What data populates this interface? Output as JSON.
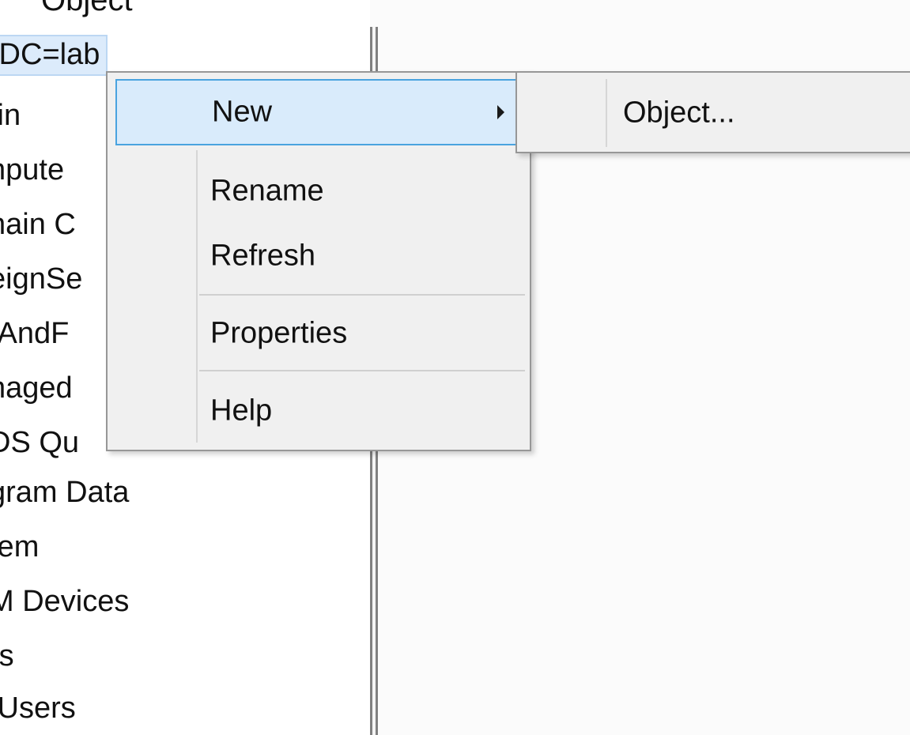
{
  "tree": {
    "column_header": "Object",
    "items": [
      {
        "label": ",DC=lab",
        "selected": true
      },
      {
        "label": "tin",
        "selected": false
      },
      {
        "label": "npute",
        "selected": false
      },
      {
        "label": "nain C",
        "selected": false
      },
      {
        "label": "eignSe",
        "selected": false
      },
      {
        "label": "tAndF",
        "selected": false
      },
      {
        "label": "naged",
        "selected": false
      },
      {
        "label": "DS Qu",
        "selected": false
      },
      {
        "label": "gram Data",
        "selected": false
      },
      {
        "label": "tem",
        "selected": false
      },
      {
        "label": "M Devices",
        "selected": false
      },
      {
        "label": "rs",
        "selected": false
      },
      {
        "label": "IUsers",
        "selected": false
      }
    ]
  },
  "context_menu": {
    "items": {
      "new": "New",
      "rename": "Rename",
      "refresh": "Refresh",
      "properties": "Properties",
      "help": "Help"
    },
    "highlighted": "new"
  },
  "submenu": {
    "object": "Object..."
  },
  "colors": {
    "highlight_fill": "#d9ebfb",
    "highlight_border": "#4aa3df",
    "menu_bg": "#f0f0f0",
    "selected_tree_fill": "#dcebfb"
  }
}
